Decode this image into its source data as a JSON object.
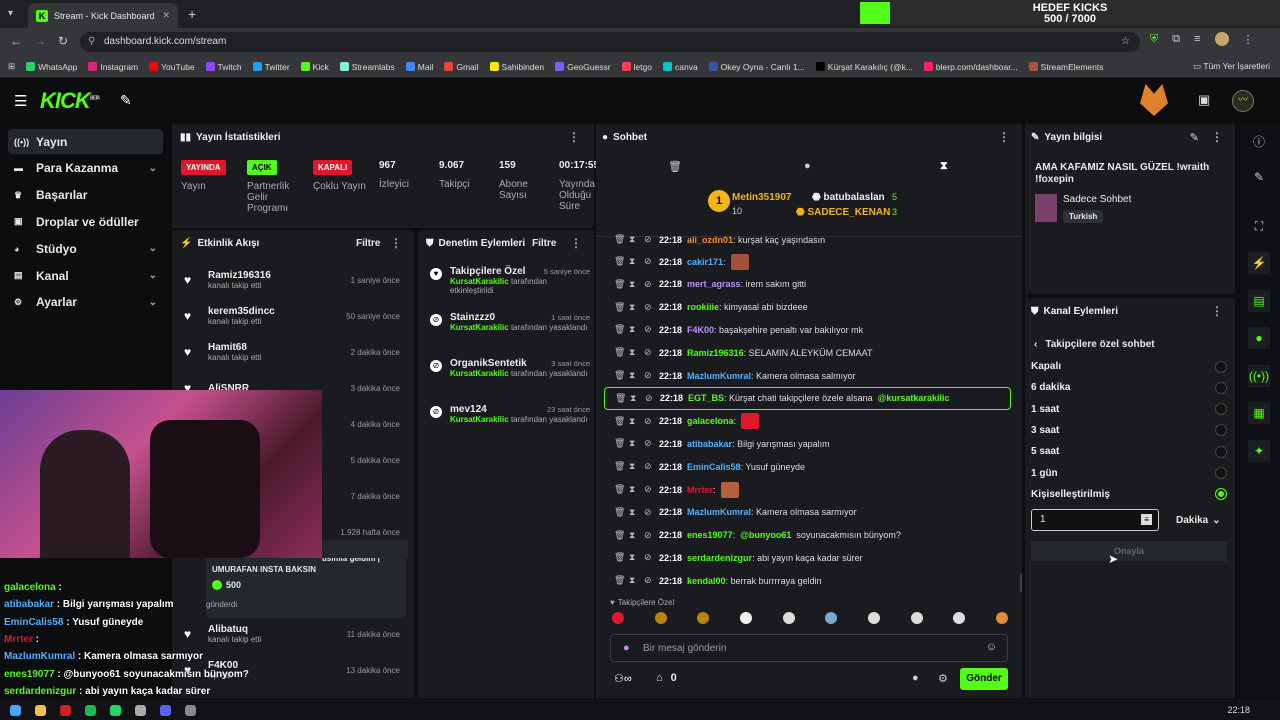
{
  "browser": {
    "tab_title": "Stream - Kick Dashboard",
    "url": "dashboard.kick.com/stream",
    "bookmarks": [
      {
        "label": "WhatsApp",
        "color": "#25d366"
      },
      {
        "label": "Instagram",
        "color": "#d62976"
      },
      {
        "label": "YouTube",
        "color": "#ff0000"
      },
      {
        "label": "Twitch",
        "color": "#9146ff"
      },
      {
        "label": "Twitter",
        "color": "#1da1f2"
      },
      {
        "label": "Kick",
        "color": "#53fc18"
      },
      {
        "label": "Streamlabs",
        "color": "#80f5d2"
      },
      {
        "label": "Mail",
        "color": "#4285f4"
      },
      {
        "label": "Gmail",
        "color": "#ea4335"
      },
      {
        "label": "Sahibinden",
        "color": "#ffe800"
      },
      {
        "label": "GeoGuessr",
        "color": "#7c5cff"
      },
      {
        "label": "letgo",
        "color": "#ff3f55"
      },
      {
        "label": "canva",
        "color": "#00c4cc"
      },
      {
        "label": "Okey Oyna - Canlı 1...",
        "color": "#3355aa"
      },
      {
        "label": "Kürşat Karakılıç (@k...",
        "color": "#000000"
      },
      {
        "label": "blerp.com/dashboar...",
        "color": "#ff2266"
      },
      {
        "label": "StreamElements",
        "color": "#aa5533"
      }
    ],
    "bookmarks_folder": "Tüm Yer İşaretleri"
  },
  "goal": {
    "title": "HEDEF KICKS",
    "progress_text": "500 / 7000",
    "fraction": 0.071
  },
  "nav": {
    "items": [
      {
        "label": "Yayın",
        "icon": "broadcast-icon",
        "active": true
      },
      {
        "label": "Para Kazanma",
        "icon": "money-icon",
        "chevron": true
      },
      {
        "label": "Başarılar",
        "icon": "trophy-icon"
      },
      {
        "label": "Droplar ve ödüller",
        "icon": "gift-icon"
      },
      {
        "label": "Stüdyo",
        "icon": "palette-icon",
        "chevron": true
      },
      {
        "label": "Kanal",
        "icon": "channel-icon",
        "chevron": true
      },
      {
        "label": "Ayarlar",
        "icon": "gear-icon",
        "chevron": true
      }
    ]
  },
  "stats": {
    "title": "Yayın İstatistikleri",
    "items": [
      {
        "badge": "YAYINDA",
        "badge_color": "#e0172a",
        "label": "Yayın"
      },
      {
        "badge": "AÇIK",
        "badge_color": "#53fc18",
        "label": "Partnerlik Gelir Programı"
      },
      {
        "badge": "KAPALI",
        "badge_color": "#e0172a",
        "label": "Çoklu Yayın"
      },
      {
        "value": "967",
        "label": "İzleyici"
      },
      {
        "value": "9.067",
        "label": "Takipçi"
      },
      {
        "value": "159",
        "label": "Abone Sayısı"
      },
      {
        "value": "00:17:55",
        "label": "Yayında Olduğu Süre"
      }
    ]
  },
  "activity": {
    "title": "Etkinlik Akışı",
    "filter": "Filtre",
    "items": [
      {
        "name": "Ramiz196316",
        "sub": "kanalı takip etti",
        "time": "1 saniye önce"
      },
      {
        "name": "kerem35dincc",
        "sub": "kanalı takip etti",
        "time": "50 saniye önce"
      },
      {
        "name": "Hamit68",
        "sub": "kanalı takip etti",
        "time": "2 dakika önce"
      },
      {
        "name": "AliSNRR",
        "sub": "",
        "time": "3 dakika önce"
      },
      {
        "name": "",
        "sub": "",
        "time": "4 dakika önce"
      },
      {
        "name": "",
        "sub": "",
        "time": "5 dakika önce"
      },
      {
        "name": "",
        "sub": "",
        "time": "7 dakika önce"
      },
      {
        "name": "",
        "sub": "",
        "time": "1.928 hafta önce"
      }
    ],
    "gift": {
      "msg1": "usimla geldim |",
      "msg2": "UMURAFAN INSTA BAKSIN",
      "amount": "500",
      "sub": "gönderdi"
    },
    "tail": [
      {
        "name": "Alibatuq",
        "sub": "kanalı takip etti",
        "time": "11 dakika önce"
      },
      {
        "name": "F4K00",
        "sub": "kip etti",
        "time": "13 dakika önce"
      }
    ]
  },
  "moderation": {
    "title": "Denetim Eylemleri",
    "filter": "Filtre",
    "items": [
      {
        "name": "Takipçilere Özel",
        "by": "KursatKarakilic",
        "sub": "tarafından etkinleştirildi",
        "time": "5 saniye önce",
        "icon": "heart-icon"
      },
      {
        "name": "Stainzzz0",
        "by": "KursatKarakilic",
        "sub": "tarafından yasaklandı",
        "time": "1 saat önce",
        "icon": "ban-icon"
      },
      {
        "name": "OrganikSentetik",
        "by": "KursatKarakilic",
        "sub": "tarafından yasaklandı",
        "time": "3 saat önce",
        "icon": "ban-icon"
      },
      {
        "name": "mev124",
        "by": "KursatKarakilic",
        "sub": "tarafından yasaklandı",
        "time": "23 saat önce",
        "icon": "ban-icon"
      }
    ]
  },
  "chat": {
    "title": "Sohbet",
    "top_gifters": [
      {
        "name": "Metin351907",
        "count": "10",
        "rank": "1"
      },
      {
        "name": "batubalaslan",
        "count": "5"
      },
      {
        "name": "SADECE_KENAN",
        "count": "3"
      }
    ],
    "messages": [
      {
        "time": "22:18",
        "user": "ali_ozdn01",
        "color": "#e58f3a",
        "text": ": kurşat kaç yaşındasın"
      },
      {
        "time": "22:18",
        "user": "cakir171",
        "color": "#4fb0ff",
        "text": ":",
        "emote": "#a0523a"
      },
      {
        "time": "22:18",
        "user": "mert_agrass",
        "color": "#c48bff",
        "text": ": irem sakım gitti"
      },
      {
        "time": "22:18",
        "user": "rookiiie",
        "color": "#53fc18",
        "text": ": kimyasal abi bizdeee"
      },
      {
        "time": "22:18",
        "user": "F4K00",
        "color": "#c48bff",
        "text": ": başakşehire penaltı var bakılıyor mk"
      },
      {
        "time": "22:18",
        "user": "Ramiz196316",
        "color": "#53fc18",
        "text": ": SELAMIN ALEYKÜM CEMAAT"
      },
      {
        "time": "22:18",
        "user": "MazlumKumral",
        "color": "#4fb0ff",
        "text": ": Kamera olmasa salmıyor"
      },
      {
        "time": "22:18",
        "user": "EGT_BS",
        "color": "#53fc18",
        "text": ": Kürşat chati takipçilere özele alsana",
        "mention": "@kursatkarakilic",
        "highlight": true
      },
      {
        "time": "22:18",
        "user": "galacelona",
        "color": "#53fc18",
        "text": ":",
        "emote": "#e0172a"
      },
      {
        "time": "22:18",
        "user": "atibabakar",
        "color": "#4fb0ff",
        "text": ": Bilgi yarışması yapalım"
      },
      {
        "time": "22:18",
        "user": "EminCalis58",
        "color": "#4fb0ff",
        "text": ": Yusuf güneyde"
      },
      {
        "time": "22:18",
        "user": "Mrrter",
        "color": "#e0172a",
        "text": ":",
        "emote": "#b5603a"
      },
      {
        "time": "22:18",
        "user": "MazlumKumral",
        "color": "#4fb0ff",
        "text": ": Kamera olmasa sarmıyor"
      },
      {
        "time": "22:18",
        "user": "enes19077",
        "color": "#53fc18",
        "text": ":",
        "mention": "@bunyoo61",
        "text2": "soyunacakmısın bünyom?"
      },
      {
        "time": "22:18",
        "user": "serdardenizgur",
        "color": "#53fc18",
        "text": ": abi yayın kaça kadar sürer"
      },
      {
        "time": "22:18",
        "user": "kendal00",
        "color": "#53fc18",
        "text": ": berrak burrrraya geldin"
      }
    ],
    "followers_only": "Takipçilere Özel",
    "input_placeholder": "Bir mesaj gönderin",
    "viewers": "0",
    "send": "Gönder"
  },
  "stream_info": {
    "title": "Yayın bilgisi",
    "stream_title": "AMA KAFAMIZ NASIL GÜZEL !wraith !foxepin",
    "category": "Sadece Sohbet",
    "language": "Turkish"
  },
  "channel_actions": {
    "title": "Kanal Eylemleri",
    "subtitle": "Takipçilere özel sohbet",
    "options": [
      "Kapalı",
      "6 dakika",
      "1 saat",
      "3 saat",
      "5 saat",
      "1 gün",
      "Kişiselleştirilmiş"
    ],
    "selected": 6,
    "input_value": "1",
    "unit": "Dakika",
    "confirm": "Onayla"
  },
  "overlay_chat": [
    {
      "user": "galacelona",
      "color": "#53fc18",
      "text": " : "
    },
    {
      "user": "atibabakar",
      "color": "#4fb0ff",
      "text": " : Bilgi yarışması yapalım"
    },
    {
      "user": "EminCalis58",
      "color": "#4fb0ff",
      "text": " : Yusuf güneyde"
    },
    {
      "user": "Mrrter",
      "color": "#e0172a",
      "text": " : "
    },
    {
      "user": "MazlumKumral",
      "color": "#4fb0ff",
      "text": " : Kamera olmasa sarmıyor"
    },
    {
      "user": "enes19077",
      "color": "#53fc18",
      "text": " : @bunyoo61 soyunacakmısın bünyom?"
    },
    {
      "user": "serdardenizgur",
      "color": "#53fc18",
      "text": " : abi yayın kaça kadar sürer"
    }
  ],
  "taskbar": {
    "time": "22:18"
  }
}
